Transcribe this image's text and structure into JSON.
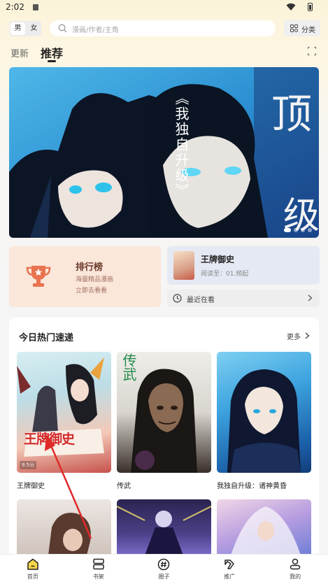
{
  "status_bar": {
    "time": "2:02"
  },
  "header": {
    "gender_male": "男",
    "gender_female": "女",
    "search_placeholder": "漫画/作者/主角",
    "category_label": "分类"
  },
  "tabs": {
    "update": "更新",
    "recommend": "推荐"
  },
  "banner": {
    "title": "《我独自升级》",
    "big_text_1": "顶",
    "big_text_2": "级"
  },
  "rank_card": {
    "title": "排行榜",
    "subtitle_1": "海量精品漫画",
    "subtitle_2": "立即去看看"
  },
  "reading_card": {
    "title": "王牌御史",
    "progress": "阅读至：01.频起"
  },
  "recent": {
    "label": "最近在看"
  },
  "hot": {
    "title": "今日热门速递",
    "more": "更多",
    "items": [
      {
        "name": "王牌御史",
        "cover_text": "王牌御史",
        "score": "9.5分"
      },
      {
        "name": "传武",
        "cover_text": "传武"
      },
      {
        "name": "我独自升级：诸神黄昏"
      }
    ]
  },
  "bottom_nav": [
    {
      "label": "首页",
      "icon": "home-icon",
      "active": true
    },
    {
      "label": "书架",
      "icon": "bookshelf-icon"
    },
    {
      "label": "圈子",
      "icon": "hashtag-icon"
    },
    {
      "label": "推广",
      "icon": "promote-icon"
    },
    {
      "label": "我的",
      "icon": "profile-icon"
    }
  ]
}
